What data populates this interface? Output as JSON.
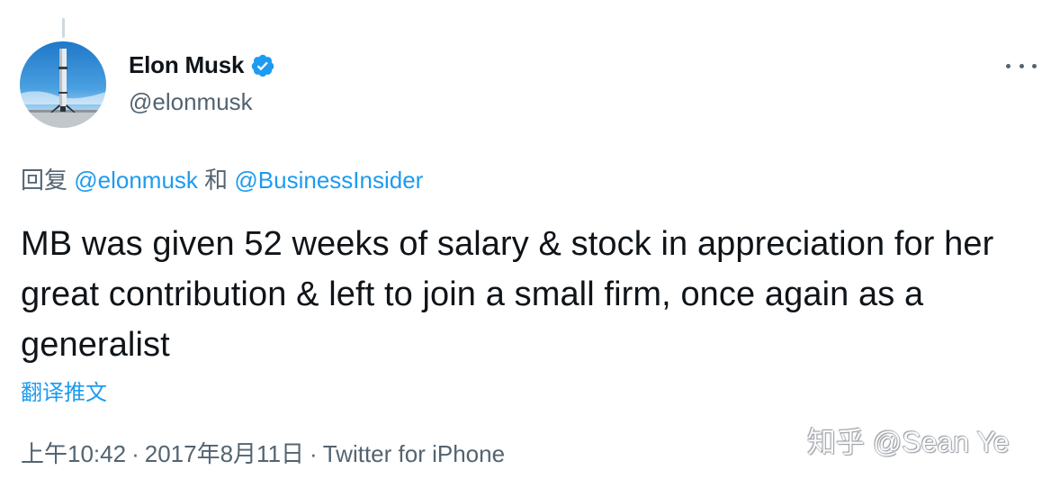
{
  "author": {
    "display_name": "Elon Musk",
    "handle": "@elonmusk",
    "verified": true,
    "verified_color": "#1d9bf0"
  },
  "reply": {
    "prefix": "回复",
    "mention_1": "@elonmusk",
    "conjunction": "和",
    "mention_2": "@BusinessInsider"
  },
  "tweet": {
    "text": "MB was given 52 weeks of salary & stock in appreciation for her great contribution & left to join a small firm, once again as a generalist",
    "translate_label": "翻译推文"
  },
  "meta": {
    "time": "上午10:42",
    "separator": "·",
    "date": "2017年8月11日",
    "source": "Twitter for iPhone"
  },
  "watermark": {
    "text": "知乎 @Sean Ye"
  },
  "colors": {
    "link": "#1d9bf0",
    "secondary_text": "#536471",
    "primary_text": "#0f1419"
  },
  "icons": {
    "more": "more-icon",
    "verified": "verified-badge-icon",
    "avatar": "rocket-avatar"
  }
}
